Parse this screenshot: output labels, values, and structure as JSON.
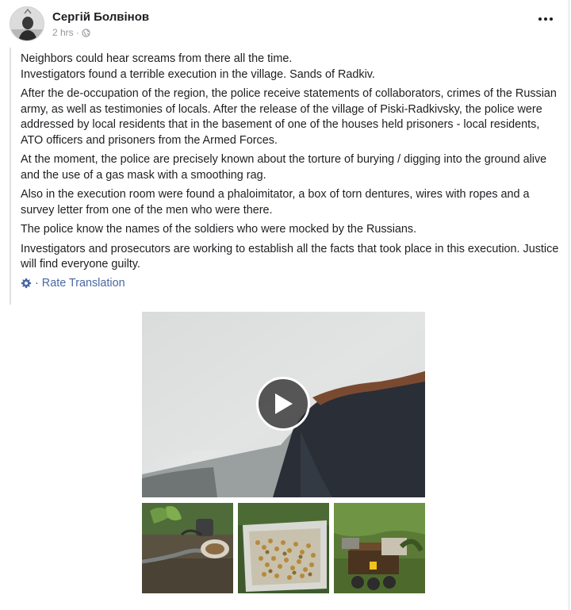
{
  "post": {
    "author": "Сергій Болвінов",
    "time": "2 hrs",
    "separator": "·",
    "paragraphs": [
      "Neighbors could hear screams from there all the time.\nInvestigators found a terrible execution in the village. Sands of Radkiv.",
      "After the de-occupation of the region, the police receive statements of collaborators, crimes of the Russian army, as well as testimonies of locals. After the release of the village of Piski-Radkivsky, the police were addressed by local residents that in the basement of one of the houses held prisoners - local residents, ATO officers and prisoners from the Armed Forces.",
      "At the moment, the police are precisely known about the torture of burying / digging into the ground alive and the use of a gas mask with a smoothing rag.",
      "Also in the execution room were found a phaloimitator, a box of torn dentures, wires with ropes and a survey letter from one of the men who were there.",
      "The police know the names of the soldiers who were mocked by the Russians.",
      "Investigators and prosecutors are working to establish all the facts that took place in this execution. Justice will find everyone guilty."
    ],
    "rate_separator": "·",
    "rate_label": "Rate Translation"
  },
  "icons": {
    "more": "more-dots-icon",
    "audience": "globe-icon",
    "translation_settings": "gear-icon",
    "play": "play-icon"
  },
  "colors": {
    "link": "#4b67a1",
    "meta": "#90949c",
    "text": "#1c1e21",
    "border": "#dddfe2"
  }
}
